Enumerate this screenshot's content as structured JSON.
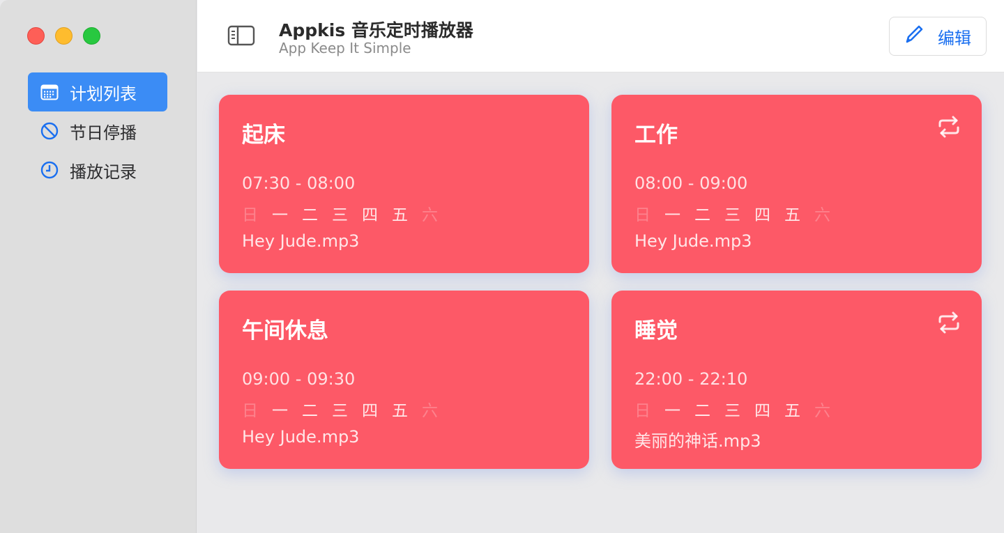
{
  "app": {
    "title": "Appkis 音乐定时播放器",
    "subtitle": "App Keep It Simple",
    "edit_label": "编辑"
  },
  "sidebar": {
    "items": [
      {
        "label": "计划列表",
        "icon": "calendar-icon",
        "active": true
      },
      {
        "label": "节日停播",
        "icon": "prohibited-icon",
        "active": false
      },
      {
        "label": "播放记录",
        "icon": "clock-icon",
        "active": false
      }
    ]
  },
  "schedules": [
    {
      "name": "起床",
      "time": "07:30 - 08:00",
      "file": "Hey Jude.mp3",
      "repeat": false,
      "days": [
        "日",
        "一",
        "二",
        "三",
        "四",
        "五",
        "六"
      ],
      "days_active": [
        false,
        true,
        true,
        true,
        true,
        true,
        false
      ]
    },
    {
      "name": "工作",
      "time": "08:00 - 09:00",
      "file": "Hey Jude.mp3",
      "repeat": true,
      "days": [
        "日",
        "一",
        "二",
        "三",
        "四",
        "五",
        "六"
      ],
      "days_active": [
        false,
        true,
        true,
        true,
        true,
        true,
        false
      ]
    },
    {
      "name": "午间休息",
      "time": "09:00 - 09:30",
      "file": "Hey Jude.mp3",
      "repeat": false,
      "days": [
        "日",
        "一",
        "二",
        "三",
        "四",
        "五",
        "六"
      ],
      "days_active": [
        false,
        true,
        true,
        true,
        true,
        true,
        false
      ]
    },
    {
      "name": "睡觉",
      "time": "22:00 - 22:10",
      "file": "美丽的神话.mp3",
      "repeat": true,
      "days": [
        "日",
        "一",
        "二",
        "三",
        "四",
        "五",
        "六"
      ],
      "days_active": [
        false,
        true,
        true,
        true,
        true,
        true,
        false
      ]
    }
  ],
  "colors": {
    "card": "#fd5967",
    "accent": "#3b8cf5",
    "edit": "#1a6ff0"
  }
}
